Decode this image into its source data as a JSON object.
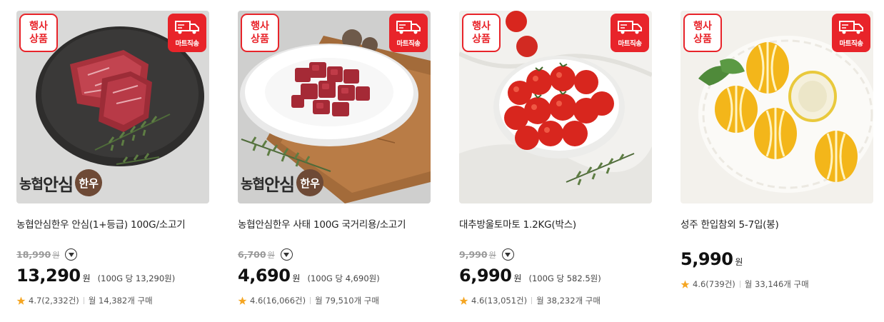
{
  "products": [
    {
      "badge_event": "행사\n상품",
      "badge_mart": "마트직송",
      "brand": {
        "part1": "농협",
        "part2": "안심",
        "part3": "한우"
      },
      "title": "농협안심한우 안심(1+등급) 100G/소고기",
      "original_price": "18,990",
      "original_unit": "원",
      "price": "13,290",
      "won": "원",
      "unit_price": "(100G 당 13,290원)",
      "rating": "4.7(2,332건)",
      "monthly": "월 14,382개 구매"
    },
    {
      "badge_event": "행사\n상품",
      "badge_mart": "마트직송",
      "brand": {
        "part1": "농협",
        "part2": "안심",
        "part3": "한우"
      },
      "title": "농협안심한우 사태 100G 국거리용/소고기",
      "original_price": "6,700",
      "original_unit": "원",
      "price": "4,690",
      "won": "원",
      "unit_price": "(100G 당 4,690원)",
      "rating": "4.6(16,066건)",
      "monthly": "월 79,510개 구매"
    },
    {
      "badge_event": "행사\n상품",
      "badge_mart": "마트직송",
      "title": "대추방울토마토 1.2KG(박스)",
      "original_price": "9,990",
      "original_unit": "원",
      "price": "6,990",
      "won": "원",
      "unit_price": "(100G 당 582.5원)",
      "rating": "4.6(13,051건)",
      "monthly": "월 38,232개 구매"
    },
    {
      "badge_event": "행사\n상품",
      "badge_mart": "마트직송",
      "title": "성주 한입참외 5-7입(봉)",
      "price": "5,990",
      "won": "원",
      "rating": "4.6(739건)",
      "monthly": "월 33,146개 구매"
    }
  ],
  "colors": {
    "accent_red": "#e8242a",
    "star": "#f5a623"
  },
  "icons": {
    "truck": "truck-icon",
    "star": "star-icon",
    "dropdown": "chevron-down-icon"
  }
}
